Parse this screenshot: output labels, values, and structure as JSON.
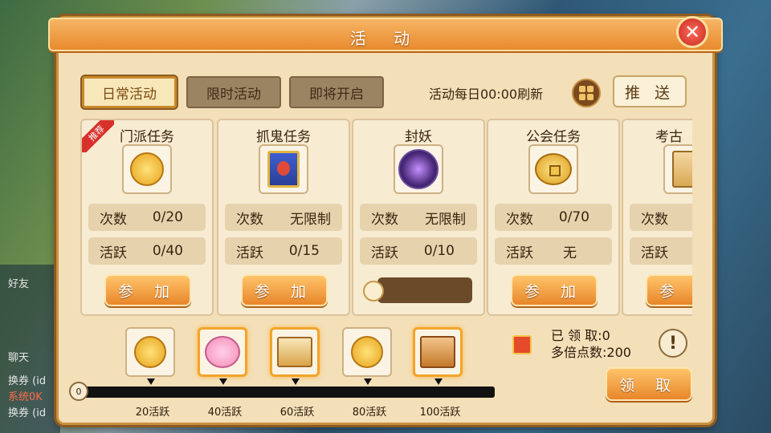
{
  "window": {
    "title": "活 动",
    "close_icon": "close-icon"
  },
  "tabs": [
    {
      "label": "日常活动",
      "active": true
    },
    {
      "label": "限时活动",
      "active": false
    },
    {
      "label": "即将开启",
      "active": false
    }
  ],
  "header": {
    "refresh_text": "活动每日00:00刷新",
    "push_label": "推 送"
  },
  "recommend_tag": "推荐",
  "cards": [
    {
      "title": "门派任务",
      "icon": "coin-icon",
      "count_label": "次数",
      "count_value": "0/20",
      "active_label": "活跃",
      "active_value": "0/40",
      "action": "参 加"
    },
    {
      "title": "抓鬼任务",
      "icon": "ghost-book-icon",
      "count_label": "次数",
      "count_value": "无限制",
      "active_label": "活跃",
      "active_value": "0/15",
      "action": "参 加"
    },
    {
      "title": "封妖",
      "icon": "swirl-icon",
      "count_label": "次数",
      "count_value": "无限制",
      "active_label": "活跃",
      "active_value": "0/10",
      "action": ""
    },
    {
      "title": "公会任务",
      "icon": "gold-coin-icon",
      "count_label": "次数",
      "count_value": "0/70",
      "active_label": "活跃",
      "active_value": "无",
      "action": "参 加"
    },
    {
      "title": "考古",
      "icon": "scroll-icon",
      "count_label": "次数",
      "count_value": "",
      "active_label": "活跃",
      "active_value": "",
      "action": "参 加"
    }
  ],
  "milestones": [
    {
      "label": "20活跃",
      "icon": "coin-reward-icon",
      "highlight": false
    },
    {
      "label": "40活跃",
      "icon": "pig-reward-icon",
      "highlight": true
    },
    {
      "label": "60活跃",
      "icon": "scroll-reward-icon",
      "highlight": true
    },
    {
      "label": "80活跃",
      "icon": "coin-reward-icon",
      "highlight": false
    },
    {
      "label": "100活跃",
      "icon": "book-reward-icon",
      "highlight": true
    }
  ],
  "progress": {
    "start_value": "0",
    "current": 0,
    "max": 100
  },
  "claim": {
    "received": "已 领 取:0",
    "multiplier": "多倍点数:200",
    "info_icon": "!",
    "claim_label": "领 取"
  },
  "background": {
    "chat_lines": [
      "换券 (id",
      "系统0K",
      "换券 (id"
    ],
    "side_labels": [
      "好友",
      "聊天"
    ]
  }
}
